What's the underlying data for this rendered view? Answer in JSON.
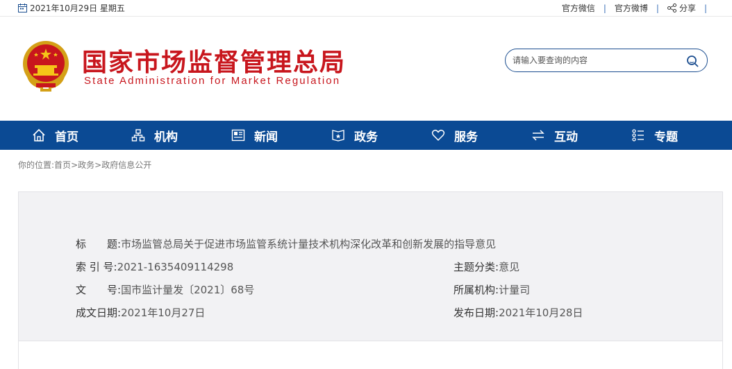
{
  "topbar": {
    "date": "2021年10月29日 星期五",
    "links": [
      "官方微信",
      "官方微博",
      "分享"
    ]
  },
  "header": {
    "title": "国家市场监督管理总局",
    "subtitle": "State Administration for Market Regulation",
    "search_placeholder": "请输入要查询的内容"
  },
  "nav": {
    "items": [
      {
        "label": "首页",
        "icon": "home-icon"
      },
      {
        "label": "机构",
        "icon": "org-chart-icon"
      },
      {
        "label": "新闻",
        "icon": "news-icon"
      },
      {
        "label": "政务",
        "icon": "affairs-icon"
      },
      {
        "label": "服务",
        "icon": "heart-icon"
      },
      {
        "label": "互动",
        "icon": "exchange-icon"
      },
      {
        "label": "专题",
        "icon": "topic-list-icon"
      }
    ]
  },
  "breadcrumb": {
    "prefix": "你的位置:",
    "items": [
      "首页",
      "政务",
      "政府信息公开"
    ],
    "sep": ">"
  },
  "info": {
    "title_label": "标　　题:",
    "title_value": "市场监管总局关于促进市场监管系统计量技术机构深化改革和创新发展的指导意见",
    "index_label": "索 引 号:",
    "index_value": "2021-1635409114298",
    "topic_label": "主题分类:",
    "topic_value": "意见",
    "doc_label": "文　　号:",
    "doc_value": "国市监计量发〔2021〕68号",
    "org_label": "所属机构:",
    "org_value": "计量司",
    "created_label": "成文日期:",
    "created_value": "2021年10月27日",
    "published_label": "发布日期:",
    "published_value": "2021年10月28日"
  },
  "colors": {
    "brand_red": "#c8161d",
    "nav_blue": "#0b4a94",
    "panel_bg": "#f2f2f4"
  }
}
